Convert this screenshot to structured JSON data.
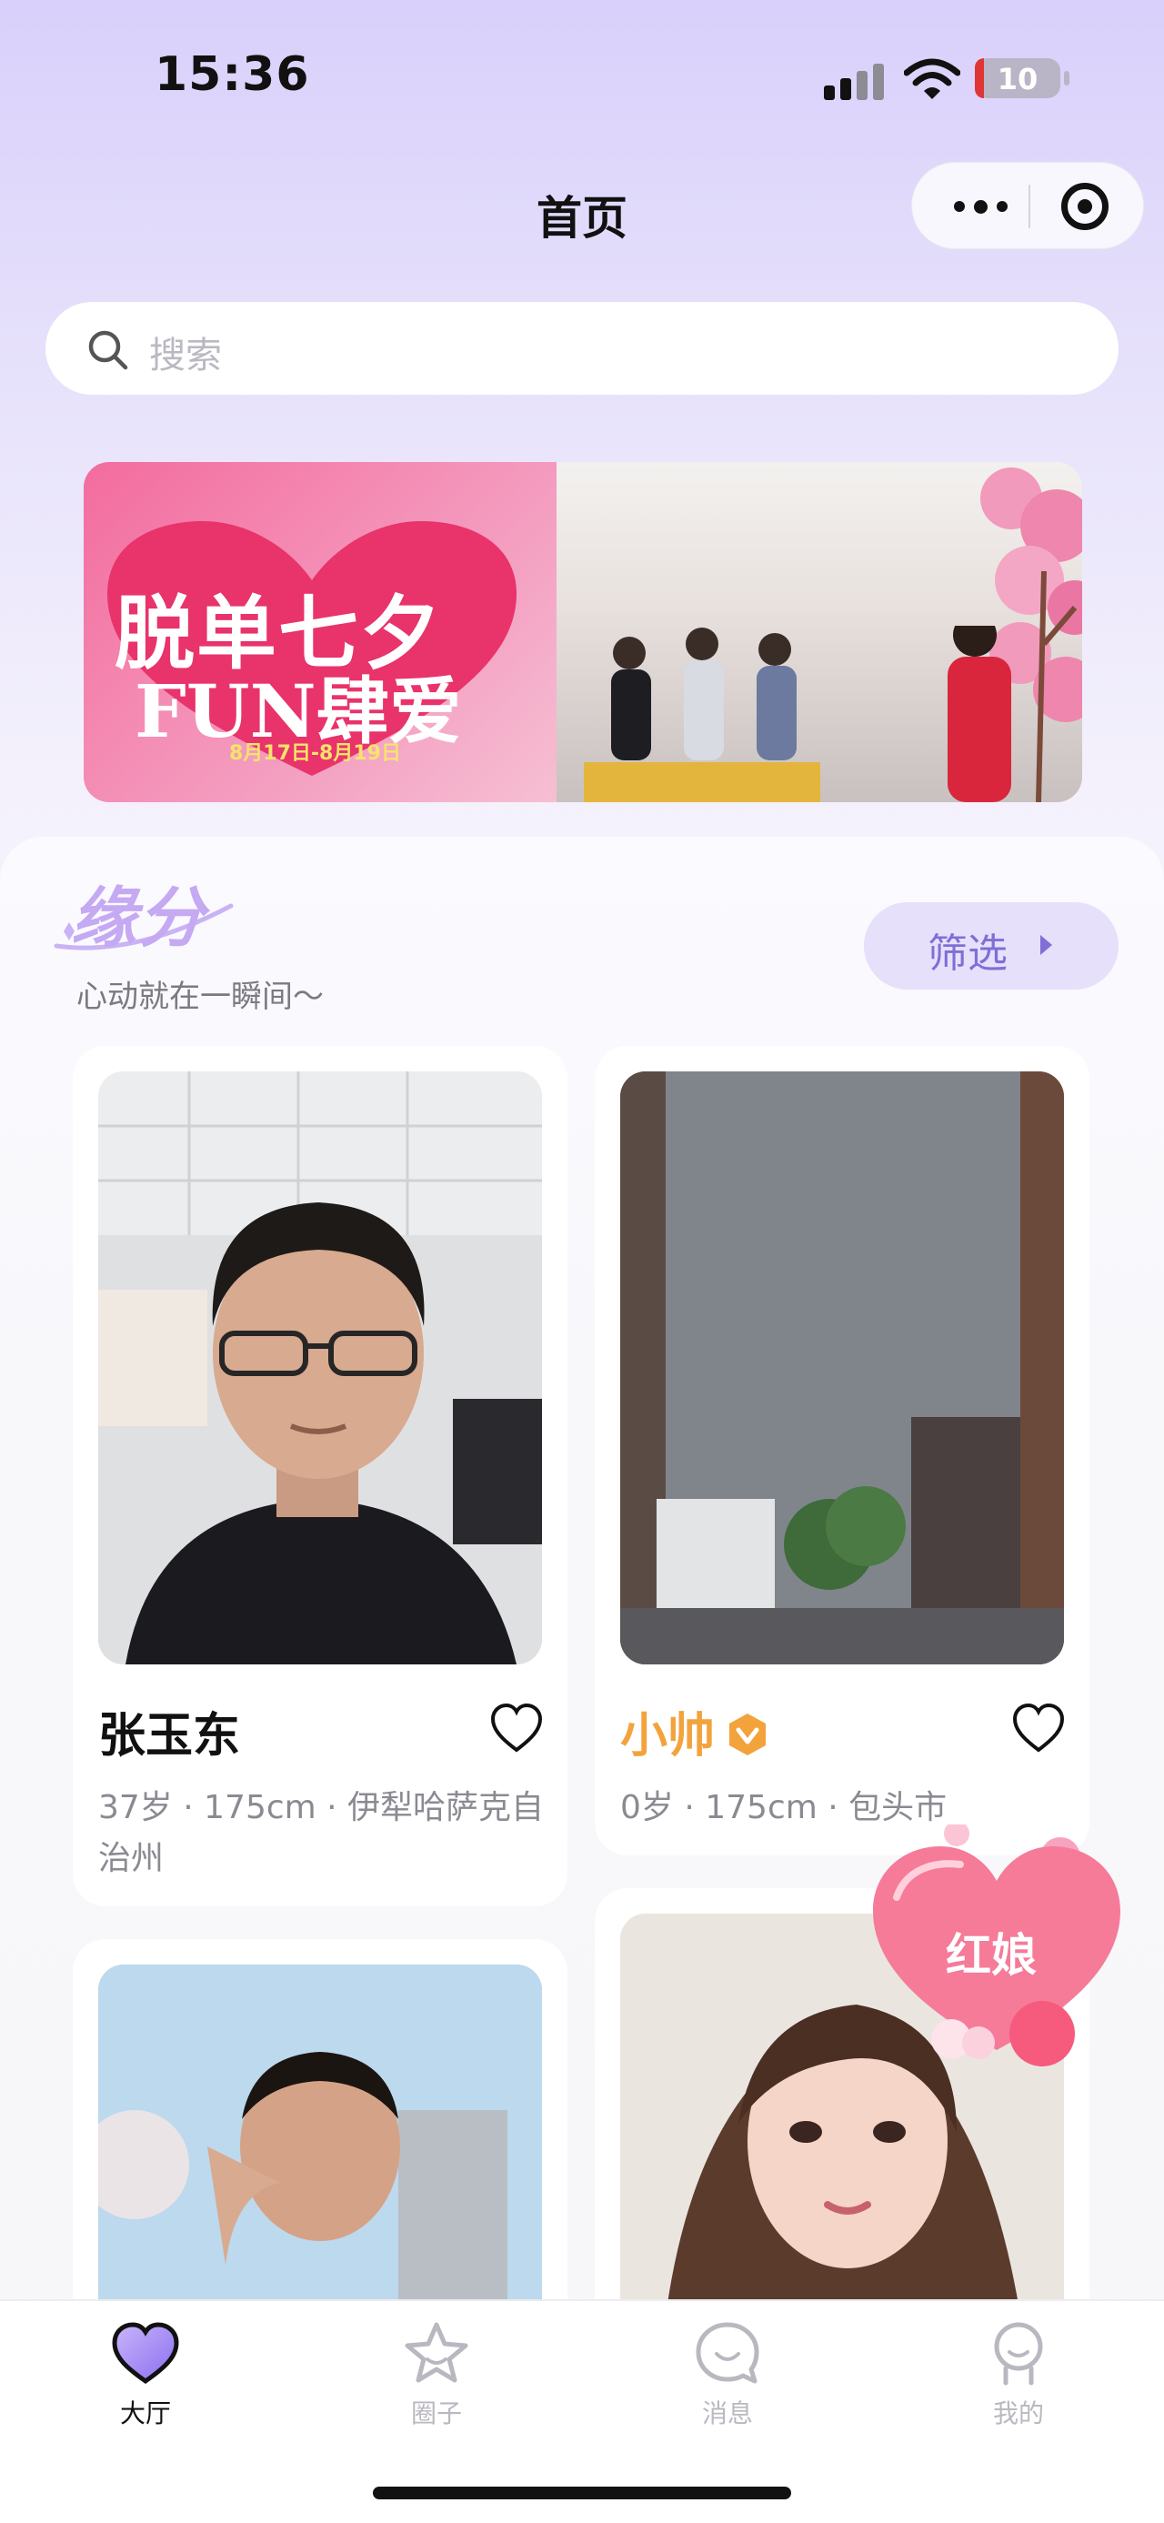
{
  "status_bar": {
    "time": "15:36",
    "battery": "10"
  },
  "nav": {
    "title": "首页"
  },
  "search": {
    "placeholder": "搜索"
  },
  "banner": {
    "line1": "脱单七夕",
    "line2": "FUN肆爱",
    "date": "8月17日-8月19日"
  },
  "section": {
    "title": "缘分",
    "subtitle": "心动就在一瞬间～",
    "filter_label": "筛选"
  },
  "cards": [
    {
      "name": "张玉东",
      "info": "37岁 · 175cm · 伊犁哈萨克自治州",
      "vip": false
    },
    {
      "name": "小帅",
      "info": "0岁 · 175cm · 包头市",
      "vip": true
    },
    {
      "name": "",
      "info": "",
      "vip": false
    },
    {
      "name": "",
      "info": "",
      "vip": false
    }
  ],
  "matchmaker": {
    "label": "红娘"
  },
  "tabs": [
    {
      "label": "大厅",
      "icon": "heart-icon",
      "active": true
    },
    {
      "label": "圈子",
      "icon": "star-icon",
      "active": false
    },
    {
      "label": "消息",
      "icon": "chat-bubble-icon",
      "active": false
    },
    {
      "label": "我的",
      "icon": "person-icon",
      "active": false
    }
  ],
  "colors": {
    "accent": "#7f6fd6",
    "vip": "#f3a33c",
    "background": "#e7e2fb"
  }
}
